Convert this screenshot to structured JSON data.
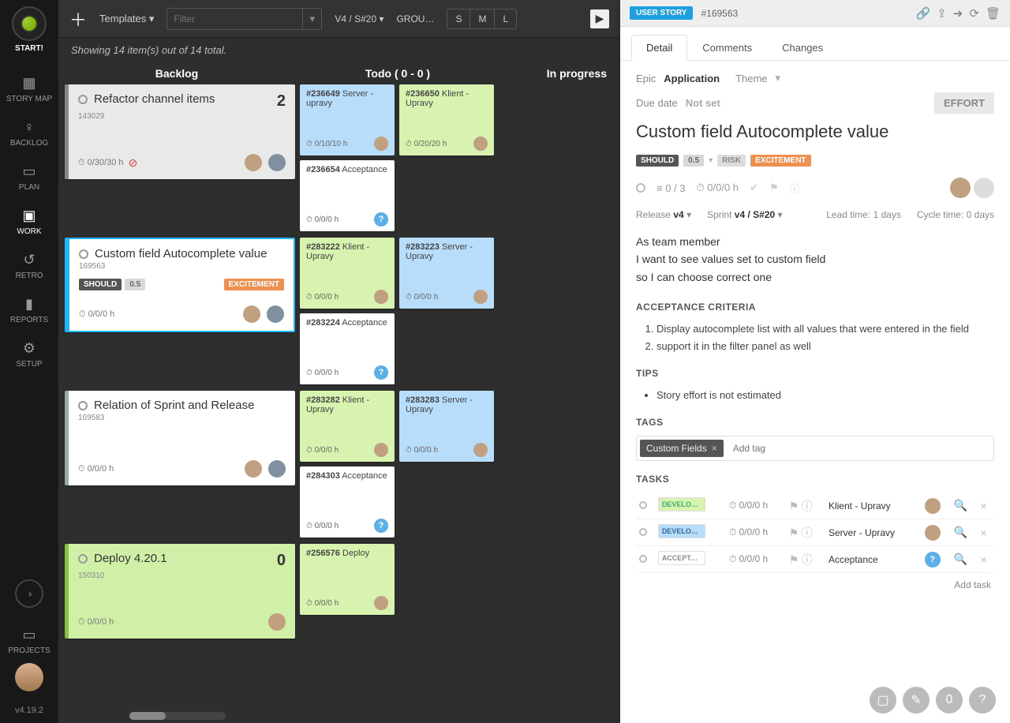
{
  "sidebar": {
    "start": "START!",
    "items": [
      {
        "icon": "▦",
        "label": "STORY MAP"
      },
      {
        "icon": "♀",
        "label": "BACKLOG"
      },
      {
        "icon": "▭",
        "label": "PLAN"
      },
      {
        "icon": "▣",
        "label": "WORK"
      },
      {
        "icon": "↺",
        "label": "RETRO"
      },
      {
        "icon": "▮",
        "label": "REPORTS"
      },
      {
        "icon": "⚙",
        "label": "SETUP"
      }
    ],
    "projects": {
      "icon": "▭",
      "label": "PROJECTS"
    },
    "version": "v4.19.2"
  },
  "toolbar": {
    "templates": "Templates ▾",
    "filter_placeholder": "Filter",
    "sprint": "V4 / S#20 ▾",
    "group": "GROU…",
    "sizes": [
      "S",
      "M",
      "L"
    ]
  },
  "status": "Showing 14 item(s) out of 14 total.",
  "columns": {
    "backlog": "Backlog",
    "todo": "Todo   (   0  -  0   )",
    "inprogress": "In progress"
  },
  "rows": [
    {
      "card": {
        "cls": "grey",
        "id": "143029",
        "title": "Refactor channel items",
        "num": "2",
        "hours": "0/30/30 h",
        "alert": true,
        "avatars": 2
      },
      "left": [
        {
          "cls": "blue",
          "id": "#236649",
          "name": "Server - upravy",
          "hours": "0/10/10 h",
          "av": true
        },
        {
          "cls": "",
          "id": "#236654",
          "name": "Acceptance",
          "hours": "0/0/0 h",
          "q": true
        }
      ],
      "right": [
        {
          "cls": "green",
          "id": "#236650",
          "name": "Klient - Upravy",
          "hours": "0/20/20 h",
          "av": true
        }
      ]
    },
    {
      "card": {
        "cls": "sel",
        "id": "169563",
        "title": "Custom field Autocomplete value",
        "hours": "0/0/0 h",
        "badges": [
          "SHOULD",
          "0.5",
          "EXCITEMENT"
        ],
        "avatars": 2
      },
      "left": [
        {
          "cls": "green",
          "id": "#283222",
          "name": "Klient - Upravy",
          "hours": "0/0/0 h",
          "av": true
        },
        {
          "cls": "",
          "id": "#283224",
          "name": "Acceptance",
          "hours": "0/0/0 h",
          "q": true
        }
      ],
      "right": [
        {
          "cls": "blue",
          "id": "#283223",
          "name": "Server - Upravy",
          "hours": "0/0/0 h",
          "av": true
        }
      ]
    },
    {
      "card": {
        "cls": "",
        "id": "169583",
        "title": "Relation of Sprint and Release",
        "hours": "0/0/0 h",
        "avatars": 2
      },
      "left": [
        {
          "cls": "green",
          "id": "#283282",
          "name": "Klient - Upravy",
          "hours": "0/0/0 h",
          "av": true
        },
        {
          "cls": "",
          "id": "#284303",
          "name": "Acceptance",
          "hours": "0/0/0 h",
          "q": true
        }
      ],
      "right": [
        {
          "cls": "blue",
          "id": "#283283",
          "name": "Server - Upravy",
          "hours": "0/0/0 h",
          "av": true
        }
      ]
    },
    {
      "card": {
        "cls": "green",
        "id": "150310",
        "title": "Deploy 4.20.1",
        "num": "0",
        "hours": "0/0/0 h",
        "avatars": 1
      },
      "left": [
        {
          "cls": "green",
          "id": "#256576",
          "name": "Deploy",
          "hours": "0/0/0 h",
          "av": true
        }
      ],
      "right": []
    }
  ],
  "detail": {
    "type": "USER STORY",
    "id": "#169563",
    "tabs": [
      "Detail",
      "Comments",
      "Changes"
    ],
    "epic_label": "Epic",
    "epic": "Application",
    "theme_label": "Theme",
    "due_label": "Due date",
    "due": "Not set",
    "effort": "EFFORT",
    "title": "Custom field Autocomplete value",
    "badges": {
      "should": "SHOULD",
      "pts": "0.5",
      "risk": "RISK",
      "exc": "EXCITEMENT"
    },
    "checklist": "0 / 3",
    "hours": "0/0/0 h",
    "release_label": "Release",
    "release": "v4",
    "sprint_label": "Sprint",
    "sprint": "v4 / S#20",
    "lead_label": "Lead time:",
    "lead": "1 days",
    "cycle_label": "Cycle time:",
    "cycle": "0 days",
    "desc": [
      "As team member",
      "I want to see values set to custom field",
      "so I can choose correct one"
    ],
    "ac_h": "ACCEPTANCE CRITERIA",
    "ac": [
      "Display autocomplete list with all values that were entered in the field",
      "support it in the filter panel as well"
    ],
    "tips_h": "TIPS",
    "tips": [
      "Story effort is not estimated"
    ],
    "tags_h": "TAGS",
    "tag": "Custom Fields",
    "add_tag": "Add tag",
    "tasks_h": "TASKS",
    "tasks": [
      {
        "chip": "dev-g",
        "chip_t": "DEVELOPM…",
        "hours": "0/0/0 h",
        "name": "Klient - Upravy",
        "av": true
      },
      {
        "chip": "dev-b",
        "chip_t": "DEVELOPM…",
        "hours": "0/0/0 h",
        "name": "Server - Upravy",
        "av": true
      },
      {
        "chip": "acc",
        "chip_t": "ACCEPTAN…",
        "hours": "0/0/0 h",
        "name": "Acceptance",
        "q": true
      }
    ],
    "add_task": "Add task"
  }
}
